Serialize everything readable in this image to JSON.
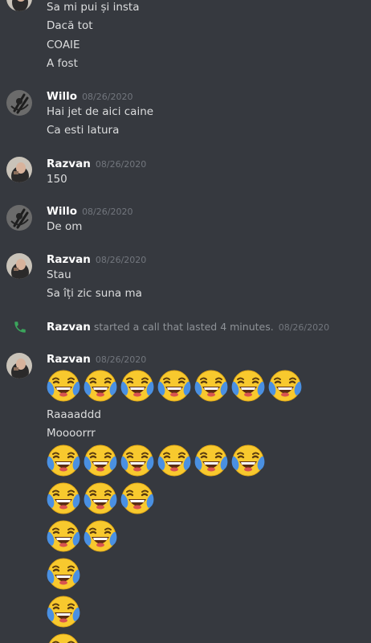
{
  "messages": {
    "top": {
      "lines": [
        "Sa mi pui și insta",
        "Dacă tot",
        "COAIE",
        "A fost"
      ]
    },
    "m1": {
      "author": "Willo",
      "timestamp": "08/26/2020",
      "lines": [
        "Hai jet de aici caine",
        "Ca esti latura"
      ]
    },
    "m2": {
      "author": "Razvan",
      "timestamp": "08/26/2020",
      "lines": [
        "150"
      ]
    },
    "m3": {
      "author": "Willo",
      "timestamp": "08/26/2020",
      "lines": [
        "De om"
      ]
    },
    "m4": {
      "author": "Razvan",
      "timestamp": "08/26/2020",
      "lines": [
        "Stau",
        "Sa îți zic suna ma"
      ]
    },
    "call": {
      "author": "Razvan",
      "text": "started a call that lasted 4 minutes.",
      "timestamp": "08/26/2020",
      "icon": "phone-icon",
      "icon_color": "#3ba55c"
    },
    "m5": {
      "author": "Razvan",
      "timestamp": "08/26/2020",
      "lines": [
        "Raaaaddd",
        "Moooorrr"
      ],
      "emoji_name": "joy-emoji",
      "emoji_rows": [
        7,
        6,
        3,
        2,
        1,
        1,
        1
      ]
    }
  },
  "colors": {
    "background": "#36393f",
    "text": "#dcddde",
    "username": "#ffffff",
    "timestamp": "#72767d"
  }
}
